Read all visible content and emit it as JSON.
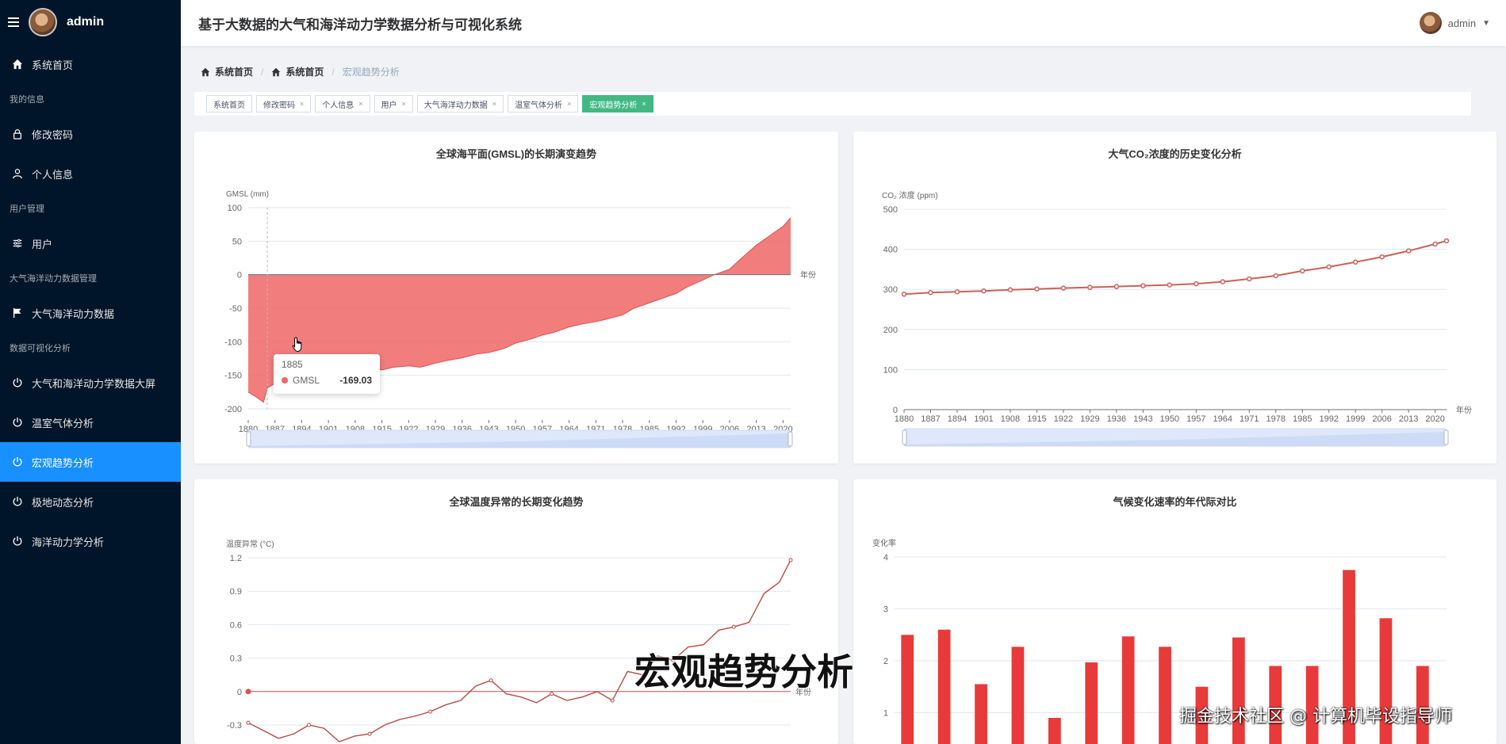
{
  "sidebar": {
    "user": "admin",
    "items": [
      {
        "type": "item",
        "label": "系统首页",
        "icon": "home-icon"
      },
      {
        "type": "group",
        "label": "我的信息"
      },
      {
        "type": "item",
        "label": "修改密码",
        "icon": "lock-icon"
      },
      {
        "type": "item",
        "label": "个人信息",
        "icon": "user-icon"
      },
      {
        "type": "group",
        "label": "用户管理"
      },
      {
        "type": "item",
        "label": "用户",
        "icon": "sliders-icon"
      },
      {
        "type": "group",
        "label": "大气海洋动力数据管理"
      },
      {
        "type": "item",
        "label": "大气海洋动力数据",
        "icon": "flag-icon"
      },
      {
        "type": "group",
        "label": "数据可视化分析"
      },
      {
        "type": "item",
        "label": "大气和海洋动力学数据大屏",
        "icon": "power-icon"
      },
      {
        "type": "item",
        "label": "温室气体分析",
        "icon": "power-icon"
      },
      {
        "type": "item",
        "label": "宏观趋势分析",
        "icon": "power-icon",
        "active": true
      },
      {
        "type": "item",
        "label": "极地动态分析",
        "icon": "power-icon"
      },
      {
        "type": "item",
        "label": "海洋动力学分析",
        "icon": "power-icon"
      }
    ]
  },
  "header": {
    "title": "基于大数据的大气和海洋动力学数据分析与可视化系统",
    "user": "admin"
  },
  "breadcrumb": [
    "系统首页",
    "系统首页",
    "宏观趋势分析"
  ],
  "tags": [
    {
      "label": "系统首页",
      "closable": false
    },
    {
      "label": "修改密码",
      "closable": true
    },
    {
      "label": "个人信息",
      "closable": true
    },
    {
      "label": "用户",
      "closable": true
    },
    {
      "label": "大气海洋动力数据",
      "closable": true
    },
    {
      "label": "温室气体分析",
      "closable": true
    },
    {
      "label": "宏观趋势分析",
      "closable": true,
      "active": true
    }
  ],
  "colors": {
    "accent": "#1890ff",
    "tag_active": "#42b983",
    "sidebar_bg": "#001529",
    "series_red": "#ee6666",
    "line_brown": "#c23531",
    "bar_red": "#e83a3a"
  },
  "tooltip": {
    "x": "1885",
    "series": "GMSL",
    "value": "-169.03"
  },
  "overlay": {
    "caption": "宏观趋势分析",
    "watermark": "掘金技术社区 @ 计算机毕设指导师"
  },
  "chart_data": [
    {
      "type": "area",
      "title": "全球海平面(GMSL)的长期演变趋势",
      "ylabel": "GMSL (mm)",
      "xlabel": "年份",
      "ylim": [
        -200,
        100
      ],
      "yticks": [
        100,
        50,
        0,
        -50,
        -100,
        -150,
        -200
      ],
      "xticks": [
        "1880",
        "1887",
        "1894",
        "1901",
        "1908",
        "1915",
        "1922",
        "1929",
        "1936",
        "1943",
        "1950",
        "1957",
        "1964",
        "1971",
        "1978",
        "1985",
        "1992",
        "1999",
        "2006",
        "2013",
        "2020"
      ],
      "x": [
        1880,
        1882,
        1884,
        1885,
        1887,
        1890,
        1894,
        1898,
        1901,
        1905,
        1908,
        1912,
        1915,
        1918,
        1922,
        1925,
        1929,
        1932,
        1936,
        1940,
        1943,
        1947,
        1950,
        1954,
        1957,
        1960,
        1964,
        1967,
        1971,
        1974,
        1978,
        1981,
        1985,
        1988,
        1992,
        1995,
        1999,
        2002,
        2006,
        2009,
        2013,
        2016,
        2020,
        2022
      ],
      "values": [
        -175,
        -182,
        -190,
        -169,
        -162,
        -158,
        -155,
        -150,
        -152,
        -148,
        -145,
        -140,
        -142,
        -138,
        -136,
        -138,
        -132,
        -128,
        -124,
        -118,
        -116,
        -110,
        -102,
        -96,
        -90,
        -86,
        -78,
        -74,
        -70,
        -66,
        -60,
        -50,
        -42,
        -36,
        -28,
        -18,
        -8,
        0,
        8,
        24,
        44,
        56,
        72,
        85
      ],
      "grid": true,
      "dataZoom": true
    },
    {
      "type": "line",
      "title": "大气CO₂浓度的历史变化分析",
      "ylabel": "CO₂ 浓度 (ppm)",
      "xlabel": "年份",
      "ylim": [
        0,
        500
      ],
      "yticks": [
        500,
        400,
        300,
        200,
        100,
        0
      ],
      "xticks": [
        "1880",
        "1887",
        "1894",
        "1901",
        "1908",
        "1915",
        "1922",
        "1929",
        "1936",
        "1943",
        "1950",
        "1957",
        "1964",
        "1971",
        "1978",
        "1985",
        "1992",
        "1999",
        "2006",
        "2013",
        "2020"
      ],
      "x": [
        1880,
        1887,
        1894,
        1901,
        1908,
        1915,
        1922,
        1929,
        1936,
        1943,
        1950,
        1957,
        1964,
        1971,
        1978,
        1985,
        1992,
        1999,
        2006,
        2013,
        2020,
        2023
      ],
      "values": [
        288,
        292,
        294,
        296,
        299,
        301,
        303,
        305,
        307,
        309,
        311,
        314,
        319,
        326,
        334,
        346,
        356,
        368,
        381,
        396,
        413,
        421
      ],
      "grid": true,
      "dataZoom": true
    },
    {
      "type": "line",
      "title": "全球温度异常的长期变化趋势",
      "ylabel": "温度异常 (°C)",
      "xlabel": "年份",
      "ylim": [
        -0.3,
        1.2
      ],
      "yticks": [
        1.2,
        0.9,
        0.6,
        0.3,
        0,
        -0.3
      ],
      "x": [
        1880,
        1884,
        1888,
        1892,
        1896,
        1900,
        1904,
        1908,
        1912,
        1916,
        1920,
        1924,
        1928,
        1932,
        1936,
        1940,
        1944,
        1948,
        1952,
        1956,
        1960,
        1964,
        1968,
        1972,
        1976,
        1980,
        1984,
        1988,
        1992,
        1996,
        2000,
        2004,
        2008,
        2012,
        2016,
        2020,
        2023
      ],
      "values": [
        -0.28,
        -0.35,
        -0.42,
        -0.38,
        -0.3,
        -0.33,
        -0.45,
        -0.4,
        -0.38,
        -0.3,
        -0.25,
        -0.22,
        -0.18,
        -0.12,
        -0.08,
        0.05,
        0.1,
        -0.02,
        -0.05,
        -0.1,
        -0.02,
        -0.08,
        -0.05,
        0.0,
        -0.08,
        0.18,
        0.15,
        0.32,
        0.28,
        0.4,
        0.42,
        0.55,
        0.58,
        0.62,
        0.88,
        0.98,
        1.18
      ],
      "grid": true
    },
    {
      "type": "bar",
      "title": "气候变化速率的年代际对比",
      "ylabel": "变化率",
      "ylim": [
        0,
        4
      ],
      "yticks": [
        4,
        3,
        2,
        1
      ],
      "values": [
        2.5,
        2.6,
        1.55,
        2.27,
        0.9,
        1.97,
        2.47,
        2.27,
        1.5,
        2.45,
        1.9,
        1.9,
        3.75,
        2.82,
        1.9
      ],
      "grid": true
    }
  ]
}
